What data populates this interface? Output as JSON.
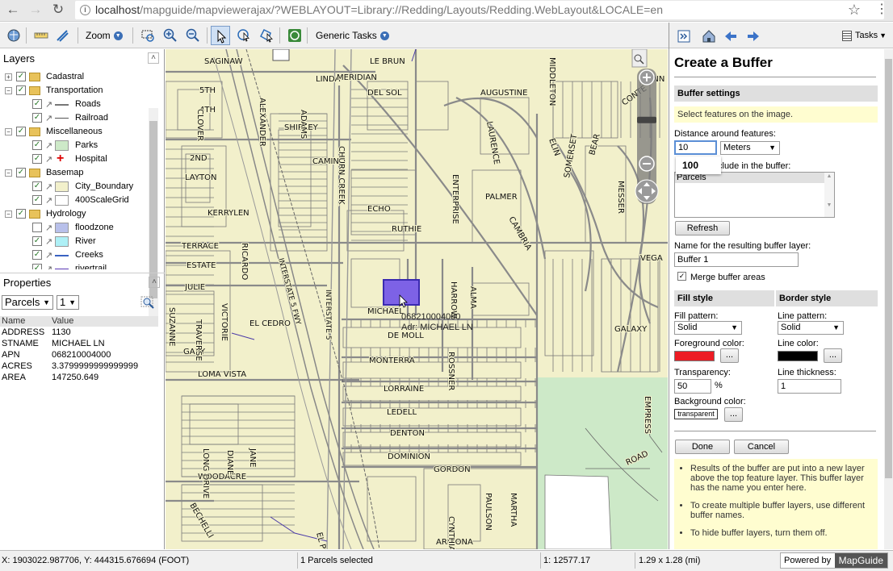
{
  "browser": {
    "url_host": "localhost",
    "url_path": "/mapguide/mapviewerajax/?WEBLAYOUT=Library://Redding/Layouts/Redding.WebLayout&LOCALE=en"
  },
  "toolbar": {
    "zoom_label": "Zoom",
    "generic_tasks_label": "Generic Tasks"
  },
  "layers_panel": {
    "title": "Layers",
    "items": [
      {
        "label": "Cadastral",
        "group": true,
        "expanded": false,
        "checked": true
      },
      {
        "label": "Transportation",
        "group": true,
        "expanded": true,
        "checked": true
      },
      {
        "label": "Roads",
        "group": false,
        "checked": true,
        "swatch": "line-gray"
      },
      {
        "label": "Railroad",
        "group": false,
        "checked": true,
        "swatch": "rail"
      },
      {
        "label": "Miscellaneous",
        "group": true,
        "expanded": true,
        "checked": true
      },
      {
        "label": "Parks",
        "group": false,
        "checked": true,
        "swatch_color": "#cde9c8"
      },
      {
        "label": "Hospital",
        "group": false,
        "checked": true,
        "swatch": "cross-red"
      },
      {
        "label": "Basemap",
        "group": true,
        "expanded": true,
        "checked": true
      },
      {
        "label": "City_Boundary",
        "group": false,
        "checked": true,
        "swatch_color": "#f2f0cb"
      },
      {
        "label": "400ScaleGrid",
        "group": false,
        "checked": true,
        "swatch_color": "#ffffff"
      },
      {
        "label": "Hydrology",
        "group": true,
        "expanded": true,
        "checked": true
      },
      {
        "label": "floodzone",
        "group": false,
        "checked": false,
        "swatch_color": "#b8c0ea"
      },
      {
        "label": "River",
        "group": false,
        "checked": true,
        "swatch_color": "#aef0f6"
      },
      {
        "label": "Creeks",
        "group": false,
        "checked": true,
        "swatch": "line-blue"
      },
      {
        "label": "rivertrail",
        "group": false,
        "checked": true,
        "swatch": "line-purple"
      }
    ]
  },
  "properties_panel": {
    "title": "Properties",
    "layer_select": "Parcels",
    "index_select": "1",
    "col_name": "Name",
    "col_value": "Value",
    "rows": [
      {
        "name": "ADDRESS",
        "value": "1130"
      },
      {
        "name": "STNAME",
        "value": "MICHAEL LN"
      },
      {
        "name": "APN",
        "value": "068210004000"
      },
      {
        "name": "ACRES",
        "value": "3.3799999999999999"
      },
      {
        "name": "AREA",
        "value": "147250.649"
      }
    ]
  },
  "map": {
    "streets": [
      "SAGINAW",
      "LE BRUN",
      "AUGUSTINE",
      "5TH",
      "4TH",
      "DEL SOL",
      "LINDA",
      "ECHO",
      "SHIRLEY",
      "2ND",
      "LAYTON",
      "KERRYLEN",
      "RUTHIE",
      "CAMINO",
      "TERRACE",
      "ESTATE",
      "JULIE",
      "MICHAEL",
      "DE MOLL",
      "MONTERRA",
      "LORRAINE",
      "LEDELL",
      "DENTON",
      "DOMINION",
      "GORDON",
      "LOMA VISTA",
      "WOODACRE",
      "ARIZONA",
      "GARY",
      "GALAXY",
      "VEGA",
      "ROAD",
      "RICARDO",
      "ALEXANDER",
      "INTERSTATE 5 FWY",
      "INTERSTATE 5",
      "EL PORTAL",
      "CHURN CREEK",
      "LAURENCE",
      "CAMBRIA",
      "SOMERSET",
      "MIDDLETON",
      "CONTE",
      "HARROW",
      "ALMA",
      "ROSSNER",
      "TRAVERSE",
      "VICTORIE",
      "SUZANNE",
      "EL CEDRO",
      "BECHELLI",
      "CYNTHIA",
      "PAULSON",
      "MARTHA",
      "LONG DRIVE",
      "DIANE",
      "JANE",
      "CLOVER",
      "ADAMS",
      "ENTERPRISE",
      "PALMER",
      "BEAR",
      "LYNN",
      "MESSER",
      "EMPRESS",
      "ELIN",
      "MERIDIAN"
    ],
    "tooltip_line1": "068210004000",
    "tooltip_line2": "Adr: MICHAEL LN",
    "zoom_level_fraction": 0.55
  },
  "task_panel": {
    "tasks_label": "Tasks",
    "title": "Create a Buffer",
    "buffer_settings": "Buffer settings",
    "select_hint": "Select features on the image.",
    "distance_label": "Distance around features:",
    "distance_value": "10",
    "autocomplete": "100",
    "units": "Meters",
    "layers_label": "clude in the buffer:",
    "layers_list": [
      "Parcels"
    ],
    "refresh": "Refresh",
    "name_label": "Name for the resulting buffer layer:",
    "name_value": "Buffer 1",
    "merge_label": "Merge buffer areas",
    "fill_style": "Fill style",
    "border_style": "Border style",
    "fill_pattern_label": "Fill pattern:",
    "fill_pattern": "Solid",
    "line_pattern_label": "Line pattern:",
    "line_pattern": "Solid",
    "fg_color_label": "Foreground color:",
    "fg_color": "#ec1c24",
    "line_color_label": "Line color:",
    "line_color": "#000000",
    "ellipsis": "...",
    "transparency_label": "Transparency:",
    "transparency_value": "50",
    "percent": "%",
    "thickness_label": "Line thickness:",
    "thickness_value": "1",
    "bg_color_label": "Background color:",
    "bg_color_value": "transparent",
    "done": "Done",
    "cancel": "Cancel",
    "notes": [
      "Results of the buffer are put into a new layer above the top feature layer. This buffer layer has the name you enter here.",
      "To create multiple buffer layers, use different buffer names.",
      "To hide buffer layers, turn them off."
    ]
  },
  "status": {
    "coords": "X: 1903022.987706, Y: 444315.676694 (FOOT)",
    "selection": "1 Parcels selected",
    "scale": "1: 12577.17",
    "size": "1.29 x 1.28 (mi)",
    "powered_by": "Powered by",
    "brand": "MapGuide"
  }
}
